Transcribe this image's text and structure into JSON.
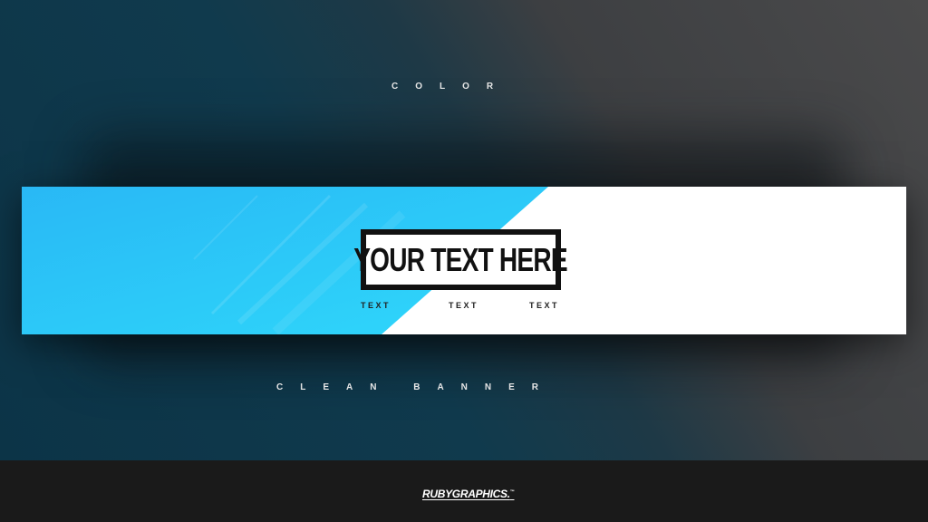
{
  "top_label": "COLOR",
  "bottom_label": "CLEAN BANNER",
  "banner": {
    "title": "YOUR TEXT HERE",
    "subtexts": [
      "TEXT",
      "TEXT",
      "TEXT"
    ],
    "accent_color": "#2bc3f7"
  },
  "footer": {
    "brand": "RUBYGRAPHICS.",
    "brand_mark": "™"
  }
}
